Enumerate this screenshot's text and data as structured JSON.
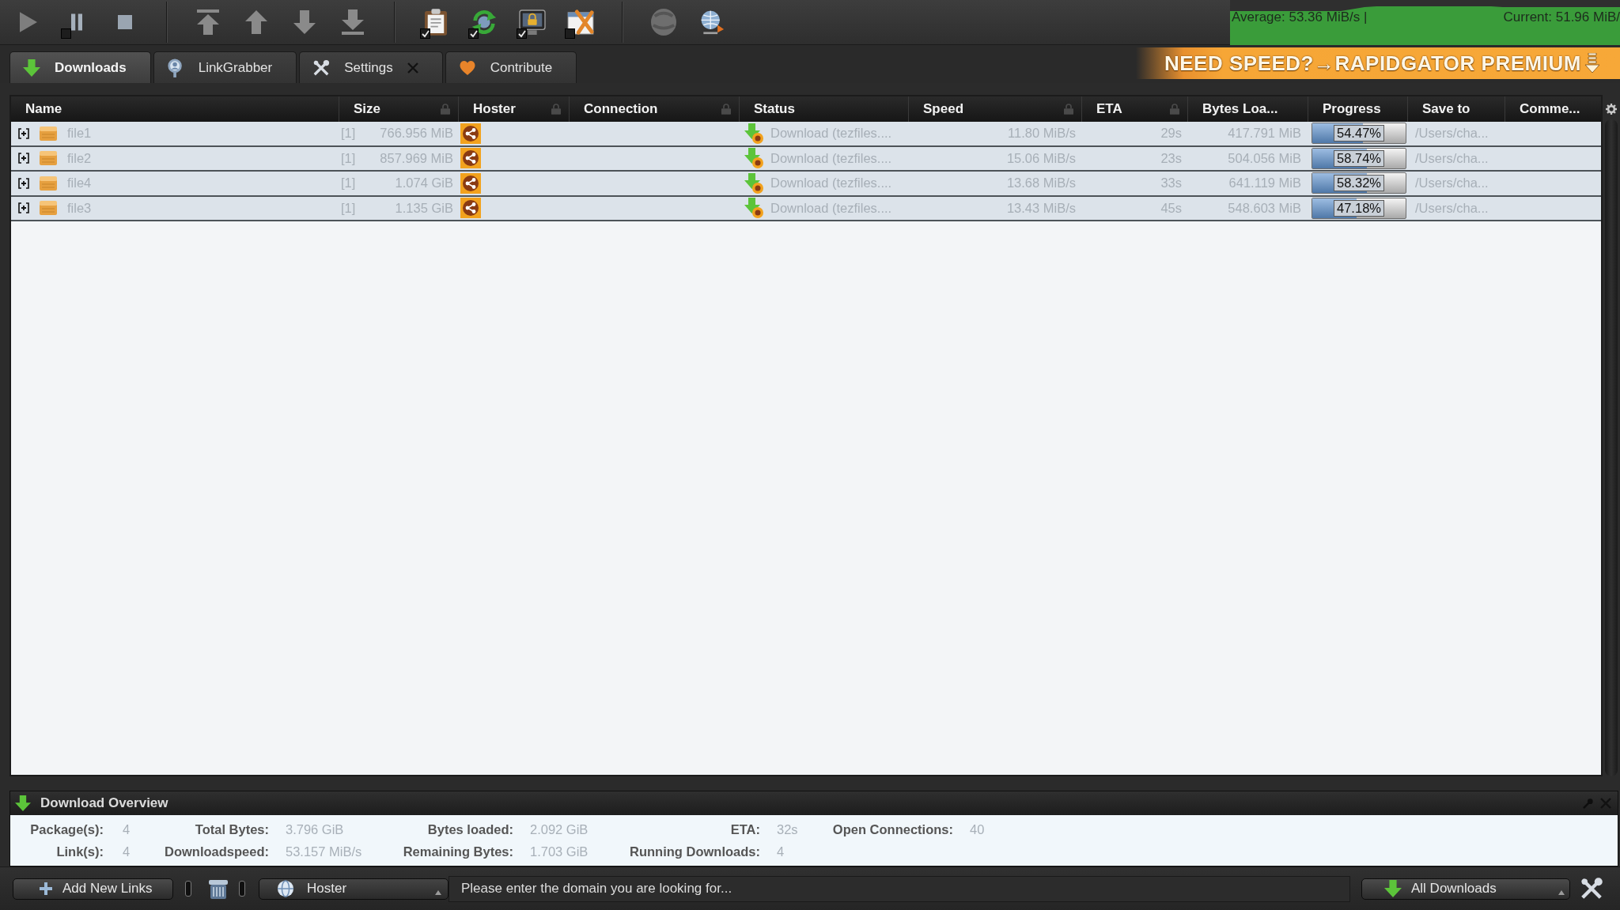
{
  "toolbar": {
    "items": [
      {
        "kind": "play"
      },
      {
        "kind": "pause",
        "checked": false
      },
      {
        "kind": "stop"
      },
      {
        "kind": "separator"
      },
      {
        "kind": "move-top"
      },
      {
        "kind": "move-up"
      },
      {
        "kind": "move-down"
      },
      {
        "kind": "move-bottom"
      },
      {
        "kind": "separator"
      },
      {
        "kind": "clipboard",
        "checked": true
      },
      {
        "kind": "reconnect",
        "checked": true
      },
      {
        "kind": "premium",
        "checked": true
      },
      {
        "kind": "clean-up",
        "checked": false
      },
      {
        "kind": "separator"
      },
      {
        "kind": "reconnect-now"
      },
      {
        "kind": "update"
      }
    ]
  },
  "speed_meter": {
    "average": "Average: 53.36 MiB/s |",
    "current": "Current: 51.96 MiB/"
  },
  "tabs": [
    {
      "label": "Downloads",
      "kind": "downloads",
      "selected": true,
      "closable": false
    },
    {
      "label": "LinkGrabber",
      "kind": "linkgrabber",
      "selected": false,
      "closable": false
    },
    {
      "label": "Settings",
      "kind": "settings",
      "selected": false,
      "closable": true
    },
    {
      "label": "Contribute",
      "kind": "contribute",
      "selected": false,
      "closable": false
    }
  ],
  "banner": {
    "text": "NEED SPEED?→RAPIDGATOR PREMIUM"
  },
  "table": {
    "columns": [
      {
        "label": "Name",
        "locked": false
      },
      {
        "label": "Size",
        "locked": true
      },
      {
        "label": "Hoster",
        "locked": true
      },
      {
        "label": "Connection",
        "locked": true
      },
      {
        "label": "Status",
        "locked": false
      },
      {
        "label": "Speed",
        "locked": true
      },
      {
        "label": "ETA",
        "locked": true
      },
      {
        "label": "Bytes Loa...",
        "locked": false
      },
      {
        "label": "Progress",
        "locked": false
      },
      {
        "label": "Save to",
        "locked": false
      },
      {
        "label": "Comme...",
        "locked": false
      }
    ],
    "rows": [
      {
        "name": "file1",
        "expanded": false,
        "links": "[1]",
        "size": "766.956 MiB",
        "status": "Download (tezfiles....",
        "speed": "11.80 MiB/s",
        "eta": "29s",
        "bytes_loaded": "417.791 MiB",
        "progress": {
          "level": 0.5447,
          "label": "54.47%"
        },
        "save_to": "/Users/cha..."
      },
      {
        "name": "file2",
        "expanded": false,
        "links": "[1]",
        "size": "857.969 MiB",
        "status": "Download (tezfiles....",
        "speed": "15.06 MiB/s",
        "eta": "23s",
        "bytes_loaded": "504.056 MiB",
        "progress": {
          "level": 0.5874,
          "label": "58.74%"
        },
        "save_to": "/Users/cha..."
      },
      {
        "name": "file4",
        "expanded": false,
        "links": "[1]",
        "size": "1.074 GiB",
        "status": "Download (tezfiles....",
        "speed": "13.68 MiB/s",
        "eta": "33s",
        "bytes_loaded": "641.119 MiB",
        "progress": {
          "level": 0.5832,
          "label": "58.32%"
        },
        "save_to": "/Users/cha..."
      },
      {
        "name": "file3",
        "expanded": false,
        "links": "[1]",
        "size": "1.135 GiB",
        "status": "Download (tezfiles....",
        "speed": "13.43 MiB/s",
        "eta": "45s",
        "bytes_loaded": "548.603 MiB",
        "progress": {
          "level": 0.4718,
          "label": "47.18%"
        },
        "save_to": "/Users/cha..."
      }
    ]
  },
  "overview": {
    "title": "Download Overview",
    "rows": [
      [
        {
          "label": "Package(s):",
          "value": "4"
        },
        {
          "label": "Total Bytes:",
          "value": "3.796 GiB"
        },
        {
          "label": "Bytes loaded:",
          "value": "2.092 GiB"
        },
        {
          "label": "ETA:",
          "value": "32s"
        },
        {
          "label": "Open Connections:",
          "value": "40"
        }
      ],
      [
        {
          "label": "Link(s):",
          "value": "4"
        },
        {
          "label": "Downloadspeed:",
          "value": "53.157 MiB/s"
        },
        {
          "label": "Remaining Bytes:",
          "value": "1.703 GiB"
        },
        {
          "label": "Running Downloads:",
          "value": "4"
        }
      ]
    ]
  },
  "bottom_bar": {
    "add_button": "Add New Links",
    "filter": "Hoster",
    "search": {
      "placeholder": "Please enter the domain you are looking for..."
    },
    "view_button": "All Downloads"
  }
}
